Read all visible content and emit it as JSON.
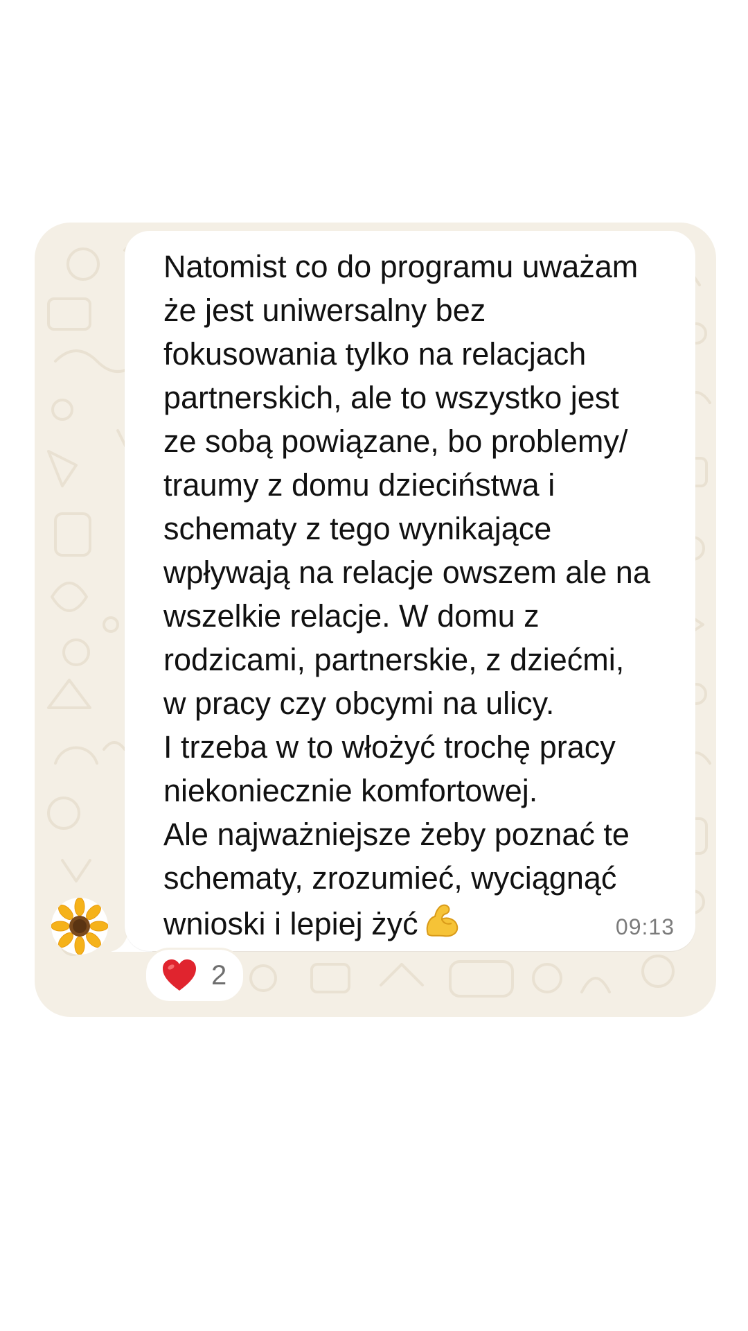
{
  "message": {
    "text": "Natomist co do programu uważam\nże jest uniwersalny bez\nfokusowania tylko na relacjach\npartnerskich, ale to wszystko jest\nze sobą powiązane, bo problemy/\ntraumy z domu dzieciństwa i\nschematy z tego wynikające\nwpływają na relacje owszem ale na\nwszelkie relacje. W domu z\nrodzicami, partnerskie, z dziećmi,\nw pracy czy obcymi na ulicy.\nI trzeba w to włożyć trochę pracy\nniekoniecznie komfortowej.\nAle najważniejsze żeby poznać te\nschematy, zrozumieć, wyciągnąć\nwnioski i lepiej żyć",
    "trailing_emoji_icon": "flexed-biceps-icon",
    "time": "09:13"
  },
  "sender": {
    "avatar_icon": "sunflower-icon"
  },
  "reaction": {
    "icon": "red-heart-icon",
    "count": "2"
  },
  "colors": {
    "chat_background": "#f4efe5",
    "bubble": "#ffffff",
    "text": "#111111",
    "timestamp": "#7b7b7b",
    "heart": "#e0242e"
  }
}
